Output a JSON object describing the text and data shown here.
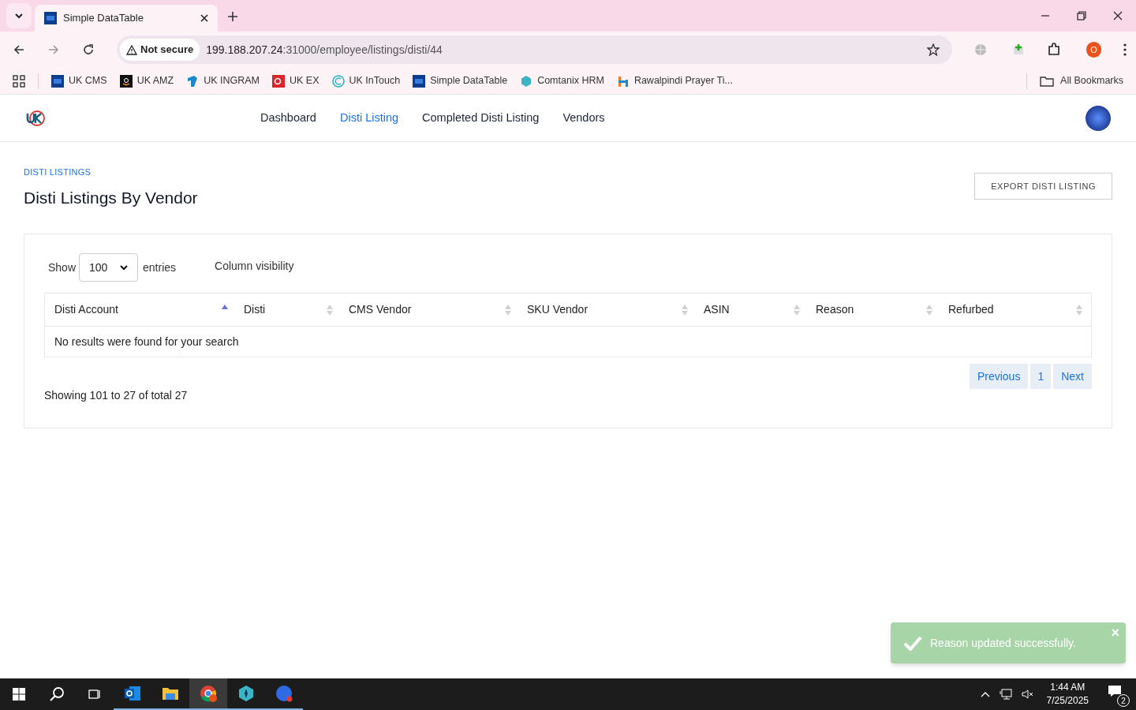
{
  "browser": {
    "tab": {
      "title": "Simple DataTable"
    },
    "security": "Not secure",
    "url_host": "199.188.207.24",
    "url_path": ":31000/employee/listings/disti/44",
    "profile": "O",
    "bookmarks": [
      {
        "kind": "df",
        "label": "UK CMS"
      },
      {
        "kind": "amazon",
        "label": "UK AMZ"
      },
      {
        "kind": "ingram",
        "label": "UK INGRAM"
      },
      {
        "kind": "ex",
        "label": "UK EX"
      },
      {
        "kind": "intouch",
        "label": "UK InTouch"
      },
      {
        "kind": "df",
        "label": "Simple DataTable"
      },
      {
        "kind": "hex",
        "label": "Comtanix HRM"
      },
      {
        "kind": "h",
        "label": "Rawalpindi Prayer Ti..."
      }
    ],
    "all_bookmarks": "All Bookmarks"
  },
  "nav": {
    "items": [
      {
        "label": "Dashboard",
        "selected": false
      },
      {
        "label": "Disti Listing",
        "selected": true
      },
      {
        "label": "Completed Disti Listing",
        "selected": false
      },
      {
        "label": "Vendors",
        "selected": false
      }
    ]
  },
  "page": {
    "breadcrumb": "DISTI LISTINGS",
    "title": "Disti Listings By Vendor",
    "export_button": "EXPORT DISTI LISTING"
  },
  "table": {
    "show_label": "Show",
    "page_size": "100",
    "entries_label": "entries",
    "column_visibility": "Column visibility",
    "columns": [
      {
        "label": "Disti Account",
        "sorted_ascending": true
      },
      {
        "label": "Disti",
        "sorted_ascending": false
      },
      {
        "label": "CMS Vendor",
        "sorted_ascending": false
      },
      {
        "label": "SKU Vendor",
        "sorted_ascending": false
      },
      {
        "label": "ASIN",
        "sorted_ascending": false
      },
      {
        "label": "Reason",
        "sorted_ascending": false
      },
      {
        "label": "Refurbed",
        "sorted_ascending": false
      }
    ],
    "empty_message": "No results were found for your search",
    "summary": "Showing 101 to 27 of total 27",
    "pagination": [
      {
        "label": "Previous",
        "kind": "prev"
      },
      {
        "label": "1",
        "kind": "page"
      },
      {
        "label": "Next",
        "kind": "next"
      }
    ]
  },
  "toast": {
    "message": "Reason updated successfully.",
    "close": "×"
  },
  "taskbar": {
    "apps": [
      {
        "kind": "outlook",
        "selected": false
      },
      {
        "kind": "explorer",
        "selected": false
      },
      {
        "kind": "chrome",
        "selected": true
      },
      {
        "kind": "diamond",
        "selected": false
      },
      {
        "kind": "zoom",
        "selected": false
      }
    ],
    "time": "1:44 AM",
    "date": "7/25/2025",
    "notifications": "2"
  }
}
